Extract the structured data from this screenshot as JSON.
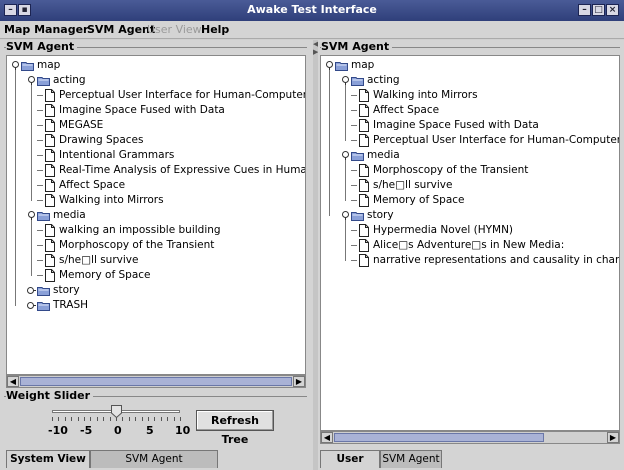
{
  "window": {
    "title": "Awake Test Interface"
  },
  "menu": [
    {
      "label": "Map Manager",
      "enabled": true
    },
    {
      "label": "SVM Agent",
      "enabled": true
    },
    {
      "label": "User View",
      "enabled": false
    },
    {
      "label": "Help",
      "enabled": true
    }
  ],
  "left_panel": {
    "group_title": "SVM Agent",
    "tree": [
      {
        "label": "map",
        "type": "folder",
        "depth": 0,
        "expanded": true
      },
      {
        "label": "acting",
        "type": "folder",
        "depth": 1,
        "expanded": true
      },
      {
        "label": "Perceptual User Interface for Human-Computer Inter",
        "type": "doc",
        "depth": 2
      },
      {
        "label": "Imagine Space Fused with Data",
        "type": "doc",
        "depth": 2
      },
      {
        "label": "MEGASE",
        "type": "doc",
        "depth": 2
      },
      {
        "label": "Drawing Spaces",
        "type": "doc",
        "depth": 2
      },
      {
        "label": "Intentional Grammars",
        "type": "doc",
        "depth": 2
      },
      {
        "label": "Real-Time Analysis of Expressive Cues in Human Mc",
        "type": "doc",
        "depth": 2
      },
      {
        "label": "Affect Space",
        "type": "doc",
        "depth": 2
      },
      {
        "label": "Walking into Mirrors",
        "type": "doc",
        "depth": 2
      },
      {
        "label": "media",
        "type": "folder",
        "depth": 1,
        "expanded": true
      },
      {
        "label": "walking an impossible building",
        "type": "doc",
        "depth": 2
      },
      {
        "label": "Morphoscopy of the Transient",
        "type": "doc",
        "depth": 2
      },
      {
        "label": "s/he□ll survive",
        "type": "doc",
        "depth": 2
      },
      {
        "label": "Memory of Space",
        "type": "doc",
        "depth": 2
      },
      {
        "label": "story",
        "type": "folder",
        "depth": 1,
        "expanded": false
      },
      {
        "label": "TRASH",
        "type": "folder",
        "depth": 1,
        "expanded": false
      }
    ],
    "scroll_position": 0.0,
    "slider": {
      "title": "Weight Slider",
      "tick_labels": [
        "-10",
        "-5",
        "0",
        "5",
        "10"
      ],
      "value": 0
    },
    "refresh_button": "Refresh Tree",
    "tabs": [
      {
        "label": "System View",
        "active": true
      },
      {
        "label": "SVM Agent Classification",
        "active": false
      }
    ]
  },
  "right_panel": {
    "group_title": "SVM Agent",
    "tree": [
      {
        "label": "map",
        "type": "folder",
        "depth": 0,
        "expanded": true
      },
      {
        "label": "acting",
        "type": "folder",
        "depth": 1,
        "expanded": true
      },
      {
        "label": "Walking into Mirrors",
        "type": "doc",
        "depth": 2
      },
      {
        "label": "Affect Space",
        "type": "doc",
        "depth": 2
      },
      {
        "label": "Imagine Space Fused with Data",
        "type": "doc",
        "depth": 2
      },
      {
        "label": "Perceptual User Interface for Human-Computer Interac",
        "type": "doc",
        "depth": 2
      },
      {
        "label": "media",
        "type": "folder",
        "depth": 1,
        "expanded": true
      },
      {
        "label": "Morphoscopy of the Transient",
        "type": "doc",
        "depth": 2
      },
      {
        "label": "s/he□ll survive",
        "type": "doc",
        "depth": 2
      },
      {
        "label": "Memory of Space",
        "type": "doc",
        "depth": 2
      },
      {
        "label": "story",
        "type": "folder",
        "depth": 1,
        "expanded": true
      },
      {
        "label": "Hypermedia Novel (HYMN)",
        "type": "doc",
        "depth": 2
      },
      {
        "label": "Alice□s Adventure□s in New Media:",
        "type": "doc",
        "depth": 2
      },
      {
        "label": "narrative representations and causality in character-ba",
        "type": "doc",
        "depth": 2
      }
    ],
    "scroll_position": 0.0,
    "tabs": [
      {
        "label": "User View",
        "active": true
      },
      {
        "label": "SVM Agent",
        "active": false
      }
    ]
  },
  "colors": {
    "title_bar": "#3a4a88",
    "folder": "#8aa0d8",
    "scroll_thumb": "#a9b2d6"
  }
}
